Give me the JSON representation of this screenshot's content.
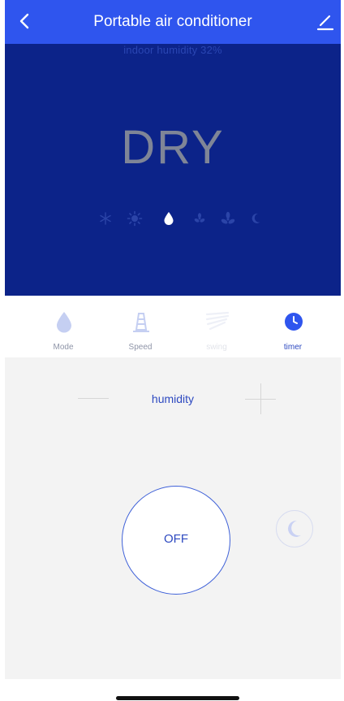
{
  "header": {
    "title": "Portable air conditioner"
  },
  "display": {
    "humidity_readout": "indoor humidity 32%",
    "mode": "DRY",
    "mode_icons": [
      "snowflake-icon",
      "sun-icon",
      "water-drop-icon",
      "fan-small-icon",
      "fan-large-icon",
      "moon-icon"
    ],
    "active_mode_icon": "water-drop-icon"
  },
  "tabs": [
    {
      "label": "Mode",
      "icon": "water-drop-icon",
      "state": "normal"
    },
    {
      "label": "Speed",
      "icon": "speed-icon",
      "state": "normal"
    },
    {
      "label": "swing",
      "icon": "swing-icon",
      "state": "disabled"
    },
    {
      "label": "timer",
      "icon": "clock-icon",
      "state": "active"
    }
  ],
  "control": {
    "parameter_label": "humidity",
    "power_label": "OFF"
  },
  "colors": {
    "header": "#2f55ee",
    "display_bg": "#0c2389",
    "accent": "#2d49c0",
    "panel_bg": "#f3f3f3"
  }
}
